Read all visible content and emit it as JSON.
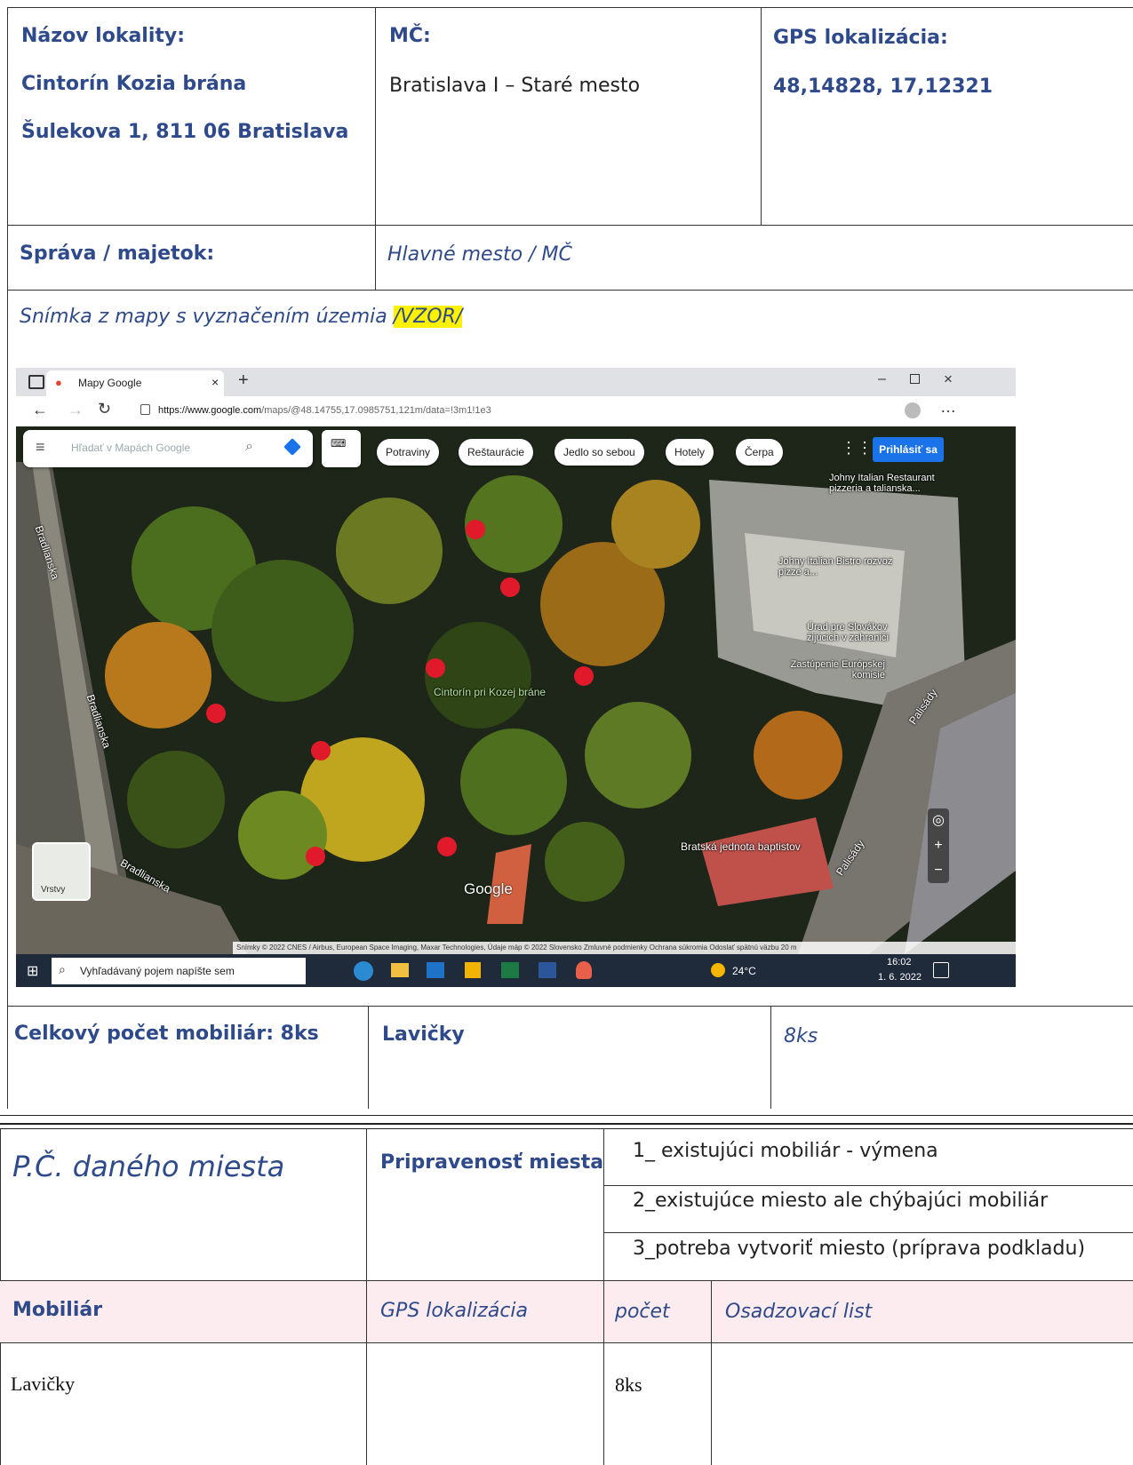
{
  "section1": {
    "locality_label": "Názov lokality:",
    "locality_name": "Cintorín Kozia brána",
    "locality_address": "Šulekova 1,  811 06 Bratislava",
    "mc_label": "MČ:",
    "mc_value": "Bratislava I –  Staré mesto",
    "gps_label": "GPS lokalizácia:",
    "gps_value": "48,14828, 17,12321"
  },
  "section2": {
    "sprava_label": "Správa / majetok:",
    "sprava_value": "Hlavné mesto / MČ"
  },
  "map_section": {
    "caption": "Snímka z mapy s vyznačením územia ",
    "caption_highlight": "/VZOR/",
    "screenshot": {
      "tab_title": "Mapy Google",
      "url_host": "https://www.google.com",
      "url_path": "/maps/@48.14755,17.0985751,121m/data=!3m1!1e3",
      "search_placeholder": "Hľadať v Mapách Google",
      "chips": [
        "Potraviny",
        "Reštaurácie",
        "Jedlo so sebou",
        "Hotely",
        "Čerpa"
      ],
      "signin": "Prihlásiť sa",
      "cemetery_label": "Cintorín pri Kozej bráne",
      "places": [
        "Johny Italian Restaurant pizzeria a talianska...",
        "Johny Italian Bistro rozvoz pizze a...",
        "Úrad pre Slovákov žijúcich v zahraničí",
        "Zastúpenie Európskej komisie",
        "Bratská jednota baptistov"
      ],
      "streets": [
        "Bradlianska",
        "Bradlianska",
        "Bradlianska",
        "Palisády",
        "Palisády"
      ],
      "layers": "Vrstvy",
      "google": "Google",
      "footer": "Snímky © 2022 CNES / Airbus, European Space Imaging, Maxar Technologies, Údaje máp © 2022   Slovensko   Zmluvné podmienky   Ochrana súkromia   Odoslať spätnú väzbu   20 m",
      "taskbar_search": "Vyhľadávaný pojem napíšte sem",
      "temp": "24°C",
      "time": "16:02",
      "date": "1. 6. 2022"
    }
  },
  "section3": {
    "total_label": "Celkový počet mobiliár: 8ks",
    "item_label": "Lavičky",
    "item_count": "8ks"
  },
  "section4": {
    "pc_label": "P.Č. daného miesta",
    "readiness_label": "Pripravenosť miesta",
    "options": [
      "1_ existujúci mobiliár - výmena",
      "2_existujúce miesto ale chýbajúci mobiliár",
      "3_potreba vytvoriť miesto (príprava podkladu)"
    ]
  },
  "table": {
    "headers": [
      "Mobiliár",
      "GPS lokalizácia",
      "počet",
      "Osadzovací list"
    ],
    "row": [
      "Lavičky",
      "",
      "8ks",
      ""
    ]
  }
}
